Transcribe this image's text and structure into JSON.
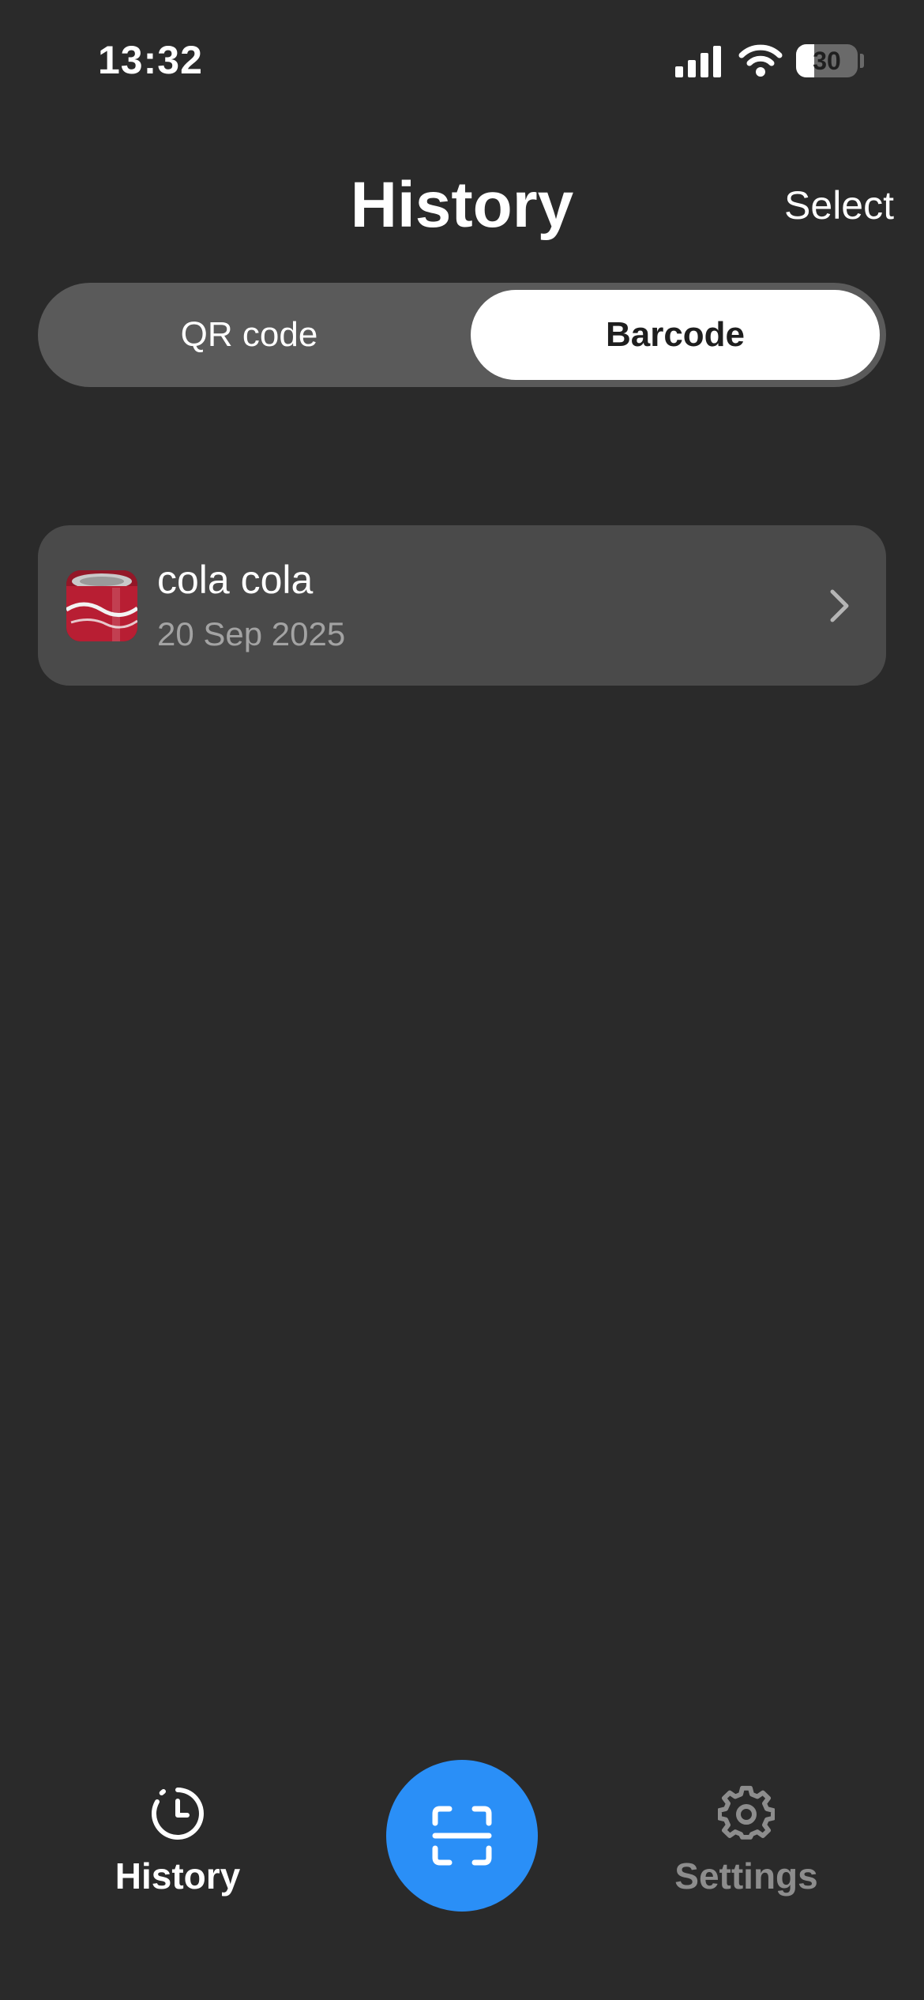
{
  "status_bar": {
    "time": "13:32",
    "battery_level": "30",
    "icons": [
      "cellular-signal-icon",
      "wifi-icon",
      "battery-icon"
    ]
  },
  "header": {
    "title": "History",
    "select_label": "Select"
  },
  "segmented_control": {
    "options": [
      {
        "label": "QR code",
        "selected": false
      },
      {
        "label": "Barcode",
        "selected": true
      }
    ]
  },
  "history_items": [
    {
      "title": "cola cola",
      "date": "20 Sep 2025",
      "thumbnail": "soda-can-photo"
    }
  ],
  "tab_bar": {
    "history_label": "History",
    "settings_label": "Settings",
    "scan_icon": "scan-frame-icon",
    "active_tab": "History"
  },
  "colors": {
    "background": "#2a2a2a",
    "card": "#4a4a4a",
    "segmented_track": "#5a5a5a",
    "accent": "#2a8ff7",
    "inactive_tab": "#8d8d8d",
    "secondary_text": "#a3a3a3"
  }
}
